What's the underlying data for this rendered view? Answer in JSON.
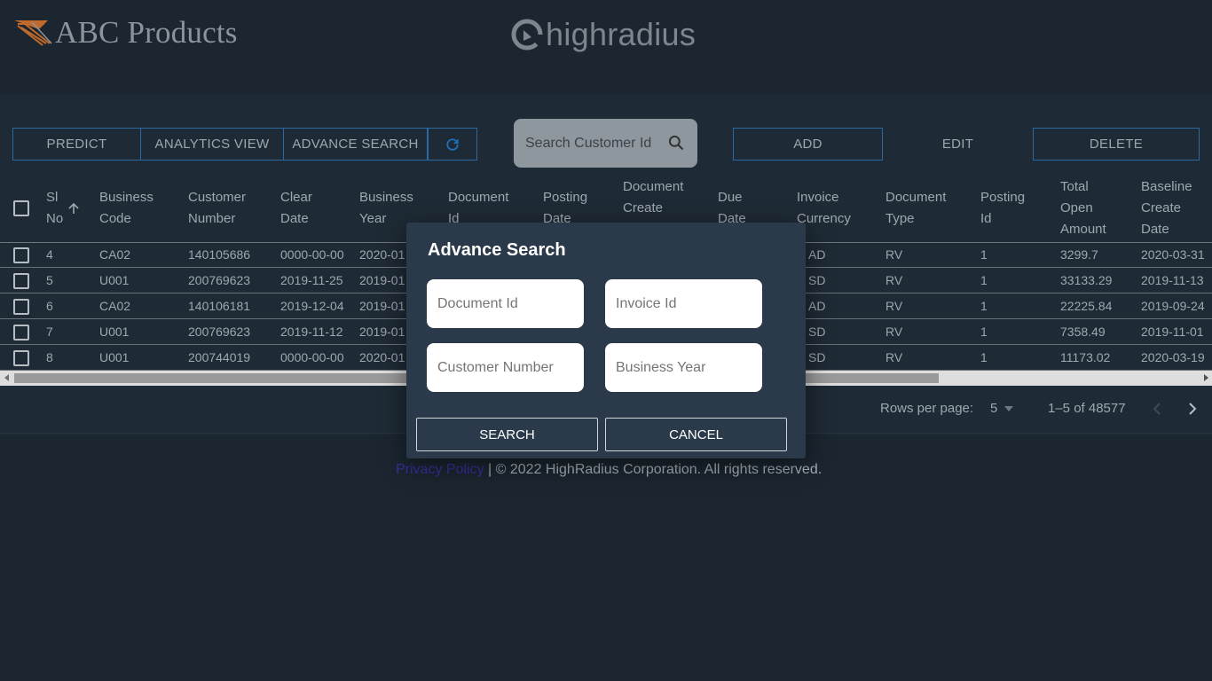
{
  "header": {
    "brand": "ABC Products",
    "partner_logo": "highradius"
  },
  "toolbar": {
    "predict": "PREDICT",
    "analytics": "ANALYTICS VIEW",
    "advance_search": "ADVANCE SEARCH",
    "refresh_icon": "refresh-icon",
    "search_placeholder": "Search Customer Id",
    "add": "ADD",
    "edit": "EDIT",
    "delete": "DELETE"
  },
  "table": {
    "columns": [
      [
        "Sl",
        "No"
      ],
      [
        "Business",
        "Code"
      ],
      [
        "Customer",
        "Number"
      ],
      [
        "Clear",
        "Date"
      ],
      [
        "Business",
        "Year"
      ],
      [
        "Document",
        "Id"
      ],
      [
        "Posting",
        "Date"
      ],
      [
        "Document",
        "Create"
      ],
      [
        "Due",
        "Date"
      ],
      [
        "Invoice",
        "Currency"
      ],
      [
        "Document",
        "Type"
      ],
      [
        "Posting",
        "Id"
      ],
      [
        "Total",
        "Open",
        "Amount"
      ],
      [
        "Baseline",
        "Create",
        "Date"
      ]
    ],
    "rows": [
      [
        "4",
        "CA02",
        "140105686",
        "0000-00-00",
        "2020-01",
        "AD",
        "RV",
        "1",
        "3299.7",
        "2020-03-31"
      ],
      [
        "5",
        "U001",
        "200769623",
        "2019-11-25",
        "2019-01",
        "SD",
        "RV",
        "1",
        "33133.29",
        "2019-11-13"
      ],
      [
        "6",
        "CA02",
        "140106181",
        "2019-12-04",
        "2019-01",
        "AD",
        "RV",
        "1",
        "22225.84",
        "2019-09-24"
      ],
      [
        "7",
        "U001",
        "200769623",
        "2019-11-12",
        "2019-01",
        "SD",
        "RV",
        "1",
        "7358.49",
        "2019-11-01"
      ],
      [
        "8",
        "U001",
        "200744019",
        "0000-00-00",
        "2020-01",
        "SD",
        "RV",
        "1",
        "11173.02",
        "2020-03-19"
      ]
    ]
  },
  "pagination": {
    "rows_per_page_label": "Rows per page:",
    "rows_per_page_value": "5",
    "range": "1–5 of 48577"
  },
  "footer": {
    "privacy": "Privacy Policy",
    "copyright": "| © 2022 HighRadius Corporation. All rights reserved."
  },
  "dialog": {
    "title": "Advance Search",
    "document_id_placeholder": "Document Id",
    "invoice_id_placeholder": "Invoice Id",
    "customer_number_placeholder": "Customer Number",
    "business_year_placeholder": "Business Year",
    "search": "SEARCH",
    "cancel": "CANCEL"
  }
}
